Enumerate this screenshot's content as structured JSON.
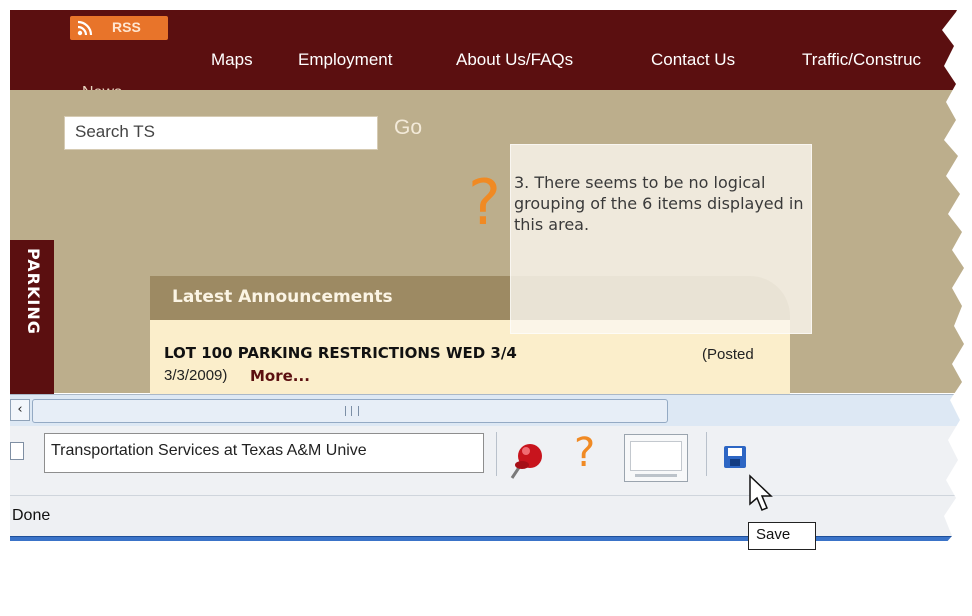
{
  "nav": {
    "rss_label": "RSS",
    "news_label": "News",
    "links": [
      "Maps",
      "Employment",
      "About Us/FAQs",
      "Contact Us",
      "Traffic/Construc"
    ]
  },
  "search": {
    "value": "Search TS",
    "go_label": "Go"
  },
  "parking_tab": {
    "label": "PARKING"
  },
  "announcements": {
    "header": "Latest Announcements",
    "item_title": "LOT 100 PARKING RESTRICTIONS WED 3/4",
    "item_posted": "(Posted",
    "item_date": "3/3/2009)",
    "more_label": "More..."
  },
  "annotation": {
    "symbol": "?",
    "text": "3. There seems to be no logical grouping of the 6 items displayed in this area."
  },
  "browser": {
    "address_value": "Transportation Services at Texas A&M Unive",
    "help_symbol": "?",
    "status_text": "Done",
    "tooltip": "Save"
  },
  "icons": {
    "rss": "rss-icon",
    "page": "page-icon",
    "pin": "pushpin-icon",
    "help": "question-mark-icon",
    "thumbnail": "thumbnail-icon",
    "save": "floppy-disk-icon",
    "cursor": "mouse-pointer-icon"
  },
  "colors": {
    "maroon": "#5b0f10",
    "tan": "#bcae8c",
    "orange": "#f08a24",
    "accent_blue": "#3a73c8"
  }
}
